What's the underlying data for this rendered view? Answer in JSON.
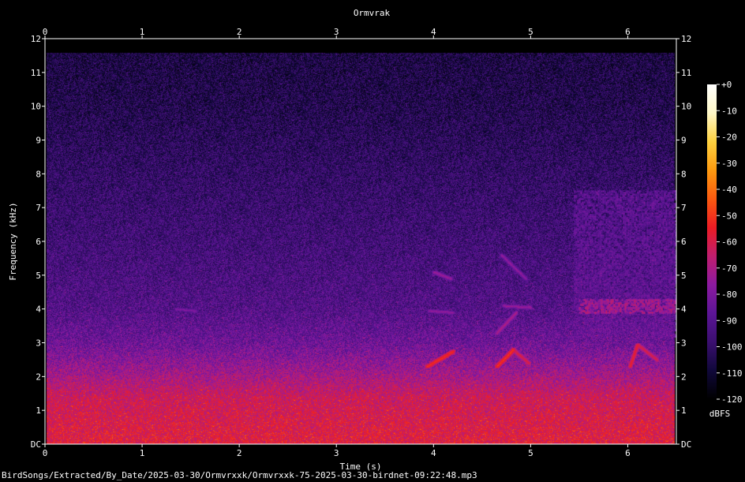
{
  "chart_data": {
    "type": "heatmap",
    "title": "Ormvrak",
    "xlabel": "Time (s)",
    "ylabel": "Frequency (kHz)",
    "xlim": [
      0,
      6.5
    ],
    "ylim": [
      0,
      12
    ],
    "x_ticks": [
      "0",
      "1",
      "2",
      "3",
      "4",
      "5",
      "6"
    ],
    "y_ticks": [
      "DC",
      "1",
      "2",
      "3",
      "4",
      "5",
      "6",
      "7",
      "8",
      "9",
      "10",
      "11",
      "12"
    ],
    "colorbar": {
      "label": "dBFS",
      "range": [
        -120,
        0
      ],
      "ticks": [
        "+0",
        "-10",
        "-20",
        "-30",
        "-40",
        "-50",
        "-60",
        "-70",
        "-80",
        "-90",
        "-100",
        "-110",
        "-120"
      ],
      "colors": [
        "#000000",
        "#10083a",
        "#3b0f70",
        "#5c1596",
        "#8c1aa0",
        "#c01e6e",
        "#ec1c24",
        "#fa5a10",
        "#fd9a10",
        "#fed240",
        "#fff8c8",
        "#ffffff"
      ]
    },
    "signal_extent_khz": 11.6,
    "background": [
      {
        "freq_khz": 0,
        "db": -58
      },
      {
        "freq_khz": 0.6,
        "db": -60
      },
      {
        "freq_khz": 1.4,
        "db": -63
      },
      {
        "freq_khz": 2.2,
        "db": -74
      },
      {
        "freq_khz": 3.0,
        "db": -84
      },
      {
        "freq_khz": 4.0,
        "db": -91
      },
      {
        "freq_khz": 6.0,
        "db": -96
      },
      {
        "freq_khz": 8.0,
        "db": -100
      },
      {
        "freq_khz": 10.0,
        "db": -105
      },
      {
        "freq_khz": 11.6,
        "db": -107
      }
    ],
    "calls": [
      {
        "t": [
          3.93,
          4.2
        ],
        "f": [
          2.3,
          2.75
        ],
        "db": -52
      },
      {
        "t": [
          4.0,
          4.18
        ],
        "f": [
          5.1,
          4.9
        ],
        "db": -74
      },
      {
        "t": [
          3.95,
          4.2
        ],
        "f": [
          3.95,
          3.9
        ],
        "db": -76
      },
      {
        "t": [
          4.65,
          4.82
        ],
        "f": [
          2.3,
          2.8
        ],
        "db": -52
      },
      {
        "t": [
          4.82,
          4.98
        ],
        "f": [
          2.8,
          2.4
        ],
        "db": -60
      },
      {
        "t": [
          4.65,
          4.85
        ],
        "f": [
          3.3,
          3.9
        ],
        "db": -70
      },
      {
        "t": [
          4.7,
          4.95
        ],
        "f": [
          5.6,
          4.9
        ],
        "db": -76
      },
      {
        "t": [
          4.72,
          5.0
        ],
        "f": [
          4.1,
          4.05
        ],
        "db": -74
      },
      {
        "t": [
          6.02,
          6.1
        ],
        "f": [
          2.3,
          2.95
        ],
        "db": -56
      },
      {
        "t": [
          6.1,
          6.3
        ],
        "f": [
          2.95,
          2.5
        ],
        "db": -60
      },
      {
        "t": [
          1.35,
          1.55
        ],
        "f": [
          4.0,
          3.95
        ],
        "db": -80
      }
    ],
    "noise_blocks": [
      {
        "t": [
          5.45,
          6.5
        ],
        "f": [
          3.2,
          7.5
        ],
        "db": -82
      },
      {
        "t": [
          5.5,
          6.5
        ],
        "f": [
          3.9,
          4.3
        ],
        "db": -66
      }
    ]
  },
  "footer_path": "BirdSongs/Extracted/By_Date/2025-03-30/Ormvrxxk/Ormvrxxk-75-2025-03-30-birdnet-09:22:48.mp3"
}
